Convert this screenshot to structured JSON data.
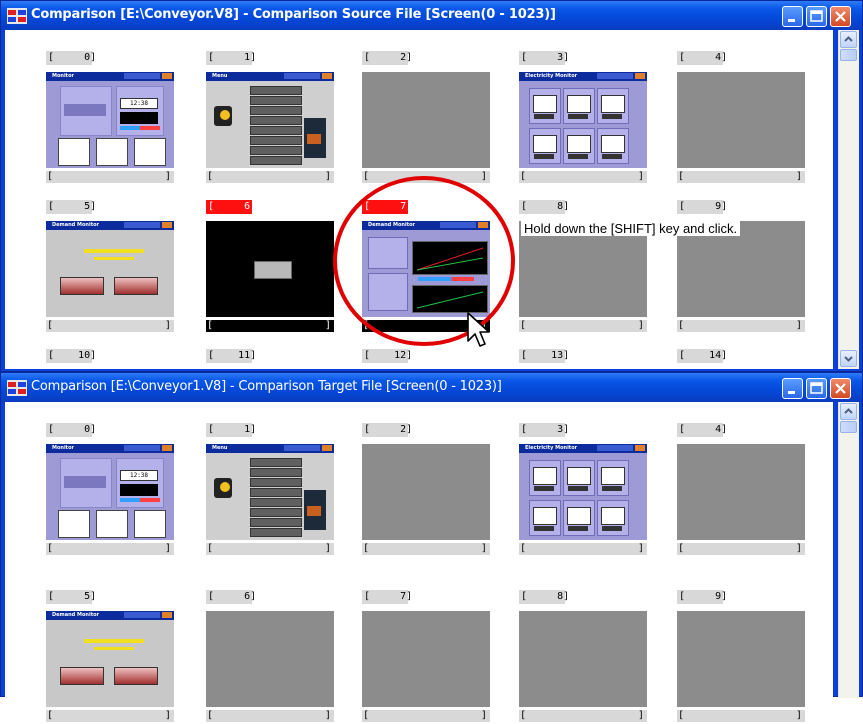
{
  "source_window": {
    "title": "Comparison [E:\\Conveyor.V8] - Comparison Source File [Screen(0 - 1023)]",
    "screens": [
      {
        "label": "[     0]",
        "name": "[                              ]",
        "preview": "Monitor",
        "kind": "monitor"
      },
      {
        "label": "[     1]",
        "name": "[                              ]",
        "preview": "Menu",
        "kind": "menu"
      },
      {
        "label": "[     2]",
        "name": "[                              ]",
        "preview": "",
        "kind": "empty"
      },
      {
        "label": "[     3]",
        "name": "[                              ]",
        "preview": "Electricity Monitor",
        "kind": "electricity"
      },
      {
        "label": "[     4]",
        "name": "[                              ]",
        "preview": "",
        "kind": "empty"
      },
      {
        "label": "[     5]",
        "name": "[                              ]",
        "preview": "Demand Monitor",
        "kind": "demand"
      },
      {
        "label": "[     6]",
        "name": "[                              ]",
        "preview": "",
        "kind": "black",
        "highlighted": true
      },
      {
        "label": "[     7]",
        "name": "[                              ]",
        "preview": "Demand Monitor",
        "kind": "demand2",
        "highlighted": true
      },
      {
        "label": "[     8]",
        "name": "[                              ]",
        "preview": "",
        "kind": "empty"
      },
      {
        "label": "[     9]",
        "name": "[                              ]",
        "preview": "",
        "kind": "empty"
      },
      {
        "label": "[    10]"
      },
      {
        "label": "[    11]"
      },
      {
        "label": "[    12]"
      },
      {
        "label": "[    13]"
      },
      {
        "label": "[    14]"
      }
    ]
  },
  "target_window": {
    "title": "Comparison [E:\\Conveyor1.V8] - Comparison Target File [Screen(0 - 1023)]",
    "screens": [
      {
        "label": "[     0]",
        "name": "[                              ]",
        "preview": "Monitor",
        "kind": "monitor"
      },
      {
        "label": "[     1]",
        "name": "[                              ]",
        "preview": "Menu",
        "kind": "menu"
      },
      {
        "label": "[     2]",
        "name": "[                              ]",
        "preview": "",
        "kind": "empty"
      },
      {
        "label": "[     3]",
        "name": "[                              ]",
        "preview": "Electricity Monitor",
        "kind": "electricity"
      },
      {
        "label": "[     4]",
        "name": "[                              ]",
        "preview": "",
        "kind": "empty"
      },
      {
        "label": "[     5]",
        "name": "[                              ]",
        "preview": "Demand Monitor",
        "kind": "demand"
      },
      {
        "label": "[     6]",
        "name": "[                              ]",
        "preview": "",
        "kind": "empty"
      },
      {
        "label": "[     7]",
        "name": "[                              ]",
        "preview": "",
        "kind": "empty"
      },
      {
        "label": "[     8]",
        "name": "[                              ]",
        "preview": "",
        "kind": "empty"
      },
      {
        "label": "[     9]",
        "name": "[                              ]",
        "preview": "",
        "kind": "empty"
      }
    ]
  },
  "annotation": {
    "caption": "Hold down the [SHIFT] key and click."
  },
  "colors": {
    "title_bar": "#0548d8",
    "highlight": "#ff1010",
    "annotation_circle": "#e00000"
  }
}
